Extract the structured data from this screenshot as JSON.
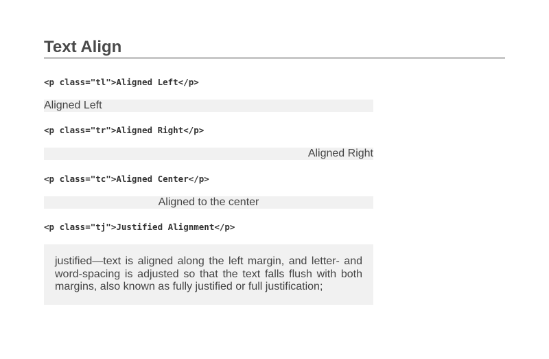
{
  "heading": "Text Align",
  "examples": [
    {
      "code": "<p class=\"tl\">Aligned Left</p>",
      "text": "Aligned Left",
      "align": "left"
    },
    {
      "code": "<p class=\"tr\">Aligned Right</p>",
      "text": "Aligned Right",
      "align": "right"
    },
    {
      "code": "<p class=\"tc\">Aligned Center</p>",
      "text": "Aligned to the center",
      "align": "center"
    },
    {
      "code": "<p class=\"tj\">Justified Alignment</p>",
      "text": "justified—text is aligned along the left margin, and letter- and word-spacing is adjusted so that the text falls flush with both margins, also known as fully justified or full justification;",
      "align": "justify"
    }
  ],
  "colors": {
    "sample_background": "#f1f1f1",
    "text": "#444444",
    "rule": "#333333"
  }
}
